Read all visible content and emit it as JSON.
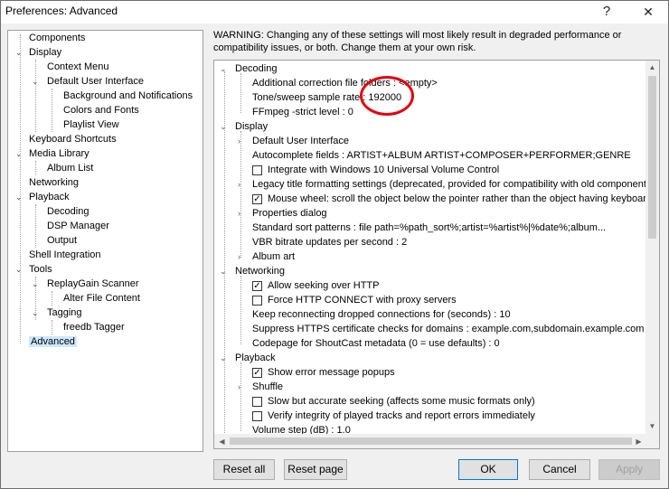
{
  "window": {
    "title": "Preferences: Advanced",
    "help_icon": "?",
    "close_icon": "✕"
  },
  "tree": {
    "components": "Components",
    "display": "Display",
    "context_menu": "Context Menu",
    "default_ui": "Default User Interface",
    "background_notifications": "Background and Notifications",
    "colors_fonts": "Colors and Fonts",
    "playlist_view": "Playlist View",
    "keyboard_shortcuts": "Keyboard Shortcuts",
    "media_library": "Media Library",
    "album_list": "Album List",
    "networking": "Networking",
    "playback": "Playback",
    "decoding": "Decoding",
    "dsp_manager": "DSP Manager",
    "output": "Output",
    "shell_integration": "Shell Integration",
    "tools": "Tools",
    "replaygain_scanner": "ReplayGain Scanner",
    "alter_file_content": "Alter File Content",
    "tagging": "Tagging",
    "freedb_tagger": "freedb Tagger",
    "advanced": "Advanced",
    "selected": "Advanced"
  },
  "warning": "WARNING: Changing any of these settings will most likely result in degraded performance or compatibility issues, or both. Change them at your own risk.",
  "advanced": {
    "decoding": "Decoding",
    "correction_folders": "Additional correction file folders : <empty>",
    "tone_rate_label": "Tone/sweep sample rate : ",
    "tone_rate_value": "192000",
    "ffmpeg_strict": "FFmpeg -strict level : 0",
    "display": "Display",
    "default_ui": "Default User Interface",
    "autocomplete": "Autocomplete fields : ARTIST+ALBUM ARTIST+COMPOSER+PERFORMER;GENRE",
    "win10_integration": "Integrate with Windows 10 Universal Volume Control",
    "legacy_title": "Legacy title formatting settings (deprecated, provided for compatibility with old components)",
    "mouse_wheel": "Mouse wheel: scroll the object below the pointer rather than the object having keyboard focus",
    "properties_dialog": "Properties dialog",
    "sort_patterns": "Standard sort patterns : file path=%path_sort%;artist=%artist%|%date%;album...",
    "vbr_updates": "VBR bitrate updates per second : 2",
    "album_art": "Album art",
    "networking": "Networking",
    "seek_http": "Allow seeking over HTTP",
    "force_connect": "Force HTTP CONNECT with proxy servers",
    "reconnect": "Keep reconnecting dropped connections for (seconds) : 10",
    "suppress_https": "Suppress HTTPS certificate checks for domains : example.com,subdomain.example.com",
    "codepage": "Codepage for ShoutCast metadata (0 = use defaults) : 0",
    "playback": "Playback",
    "show_errors": "Show error message popups",
    "shuffle": "Shuffle",
    "slow_seek": "Slow but accurate seeking (affects some music formats only)",
    "verify_integrity": "Verify integrity of played tracks and report errors immediately",
    "volume_step": "Volume step (dB) : 1.0"
  },
  "checkboxes": {
    "win10_integration": false,
    "mouse_wheel": true,
    "seek_http": true,
    "force_connect": false,
    "show_errors": true,
    "slow_seek": false,
    "verify_integrity": false
  },
  "buttons": {
    "reset_all": "Reset all",
    "reset_page": "Reset page",
    "ok": "OK",
    "cancel": "Cancel",
    "apply": "Apply"
  },
  "glyphs": {
    "expanded": "⌄",
    "collapsed": "›",
    "check": "✓",
    "up": "▲",
    "down": "▼",
    "left": "◀",
    "right": "▶"
  },
  "colors": {
    "selection": "#cce8ff",
    "annotation_circle": "#e0000f",
    "default_button_border": "#0078d7"
  }
}
